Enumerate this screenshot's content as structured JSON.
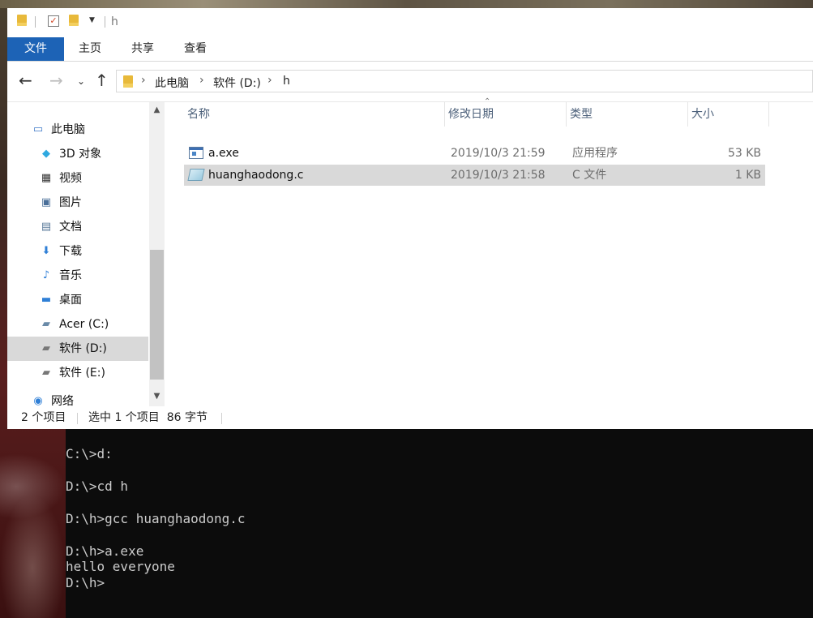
{
  "window": {
    "title": "h"
  },
  "ribbon": {
    "tabs": [
      "文件",
      "主页",
      "共享",
      "查看"
    ]
  },
  "address": {
    "crumbs": [
      "此电脑",
      "软件 (D:)",
      "h"
    ]
  },
  "nav": {
    "items": [
      {
        "label": "此电脑",
        "icon": "computer-icon"
      },
      {
        "label": "3D 对象",
        "icon": "cube-icon"
      },
      {
        "label": "视频",
        "icon": "video-icon"
      },
      {
        "label": "图片",
        "icon": "picture-icon"
      },
      {
        "label": "文档",
        "icon": "document-icon"
      },
      {
        "label": "下载",
        "icon": "download-icon"
      },
      {
        "label": "音乐",
        "icon": "music-icon"
      },
      {
        "label": "桌面",
        "icon": "desktop-icon"
      },
      {
        "label": "Acer (C:)",
        "icon": "drive-icon"
      },
      {
        "label": "软件 (D:)",
        "icon": "drive-icon",
        "selected": true
      },
      {
        "label": "软件 (E:)",
        "icon": "drive-icon"
      },
      {
        "label": "网络",
        "icon": "network-icon"
      }
    ]
  },
  "files": {
    "headers": [
      "名称",
      "修改日期",
      "类型",
      "大小"
    ],
    "rows": [
      {
        "name": "a.exe",
        "date": "2019/10/3 21:59",
        "type": "应用程序",
        "size": "53 KB",
        "icon": "exe-file-icon"
      },
      {
        "name": "huanghaodong.c",
        "date": "2019/10/3 21:58",
        "type": "C 文件",
        "size": "1 KB",
        "icon": "c-file-icon",
        "selected": true
      }
    ]
  },
  "status": {
    "count": "2 个项目",
    "selection": "选中 1 个项目  86 字节"
  },
  "console": {
    "lines": [
      "C:\\>d:",
      "",
      "D:\\>cd h",
      "",
      "D:\\h>gcc huanghaodong.c",
      "",
      "D:\\h>a.exe",
      "hello everyone",
      "D:\\h>"
    ]
  },
  "colors": {
    "accent": "#1d63b6",
    "selection": "#d9d9d9",
    "console_bg": "#0c0c0c",
    "console_fg": "#cccccc"
  }
}
